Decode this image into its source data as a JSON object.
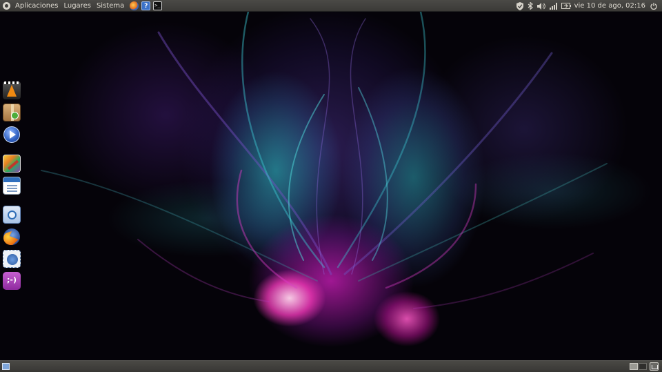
{
  "top_panel": {
    "menus": [
      "Aplicaciones",
      "Lugares",
      "Sistema"
    ],
    "launchers": [
      "firefox-icon",
      "help-icon",
      "terminal-icon"
    ],
    "help_glyph": "?",
    "terminal_glyph": ">_",
    "tray_icons": [
      "shield-icon",
      "bluetooth-icon",
      "volume-icon",
      "network-signal-icon",
      "battery-icon",
      "power-icon"
    ],
    "clock": "vie 10 de ago, 02:16"
  },
  "dock": {
    "items": [
      {
        "name": "vlc-icon"
      },
      {
        "name": "package-installer-icon"
      },
      {
        "name": "media-player-icon"
      },
      {
        "name": "paint-icon"
      },
      {
        "name": "writer-document-icon"
      },
      {
        "name": "chromium-browser-icon"
      },
      {
        "name": "firefox-icon"
      },
      {
        "name": "mail-client-icon"
      },
      {
        "name": "chat-icon",
        "glyph": ";-)"
      }
    ]
  },
  "bottom_panel": {
    "items": [
      "show-desktop-icon",
      "workspace-switcher",
      "trash-icon"
    ],
    "workspaces": 2,
    "active_workspace": 1
  },
  "colors": {
    "panel": "#3f3e3b",
    "panel_text": "#dfdbd2",
    "wallpaper_pink": "#ff3cbe",
    "wallpaper_cyan": "#28c8c8",
    "wallpaper_violet": "#5a3caa"
  }
}
